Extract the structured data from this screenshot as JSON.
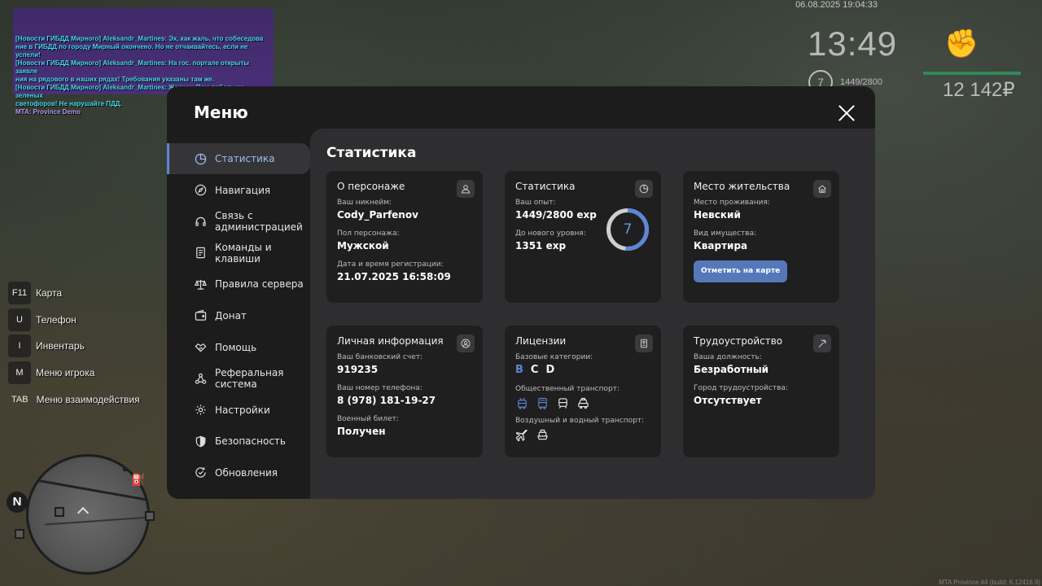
{
  "hud": {
    "datetime": "06.08.2025 19:04:33",
    "clock": "13:49",
    "level": "7",
    "exp": "1449/2800",
    "money": "12 142₽",
    "build": "MTA Province #4 (build: 6.12416.9)"
  },
  "chat": {
    "lines": [
      "[Новости ГИБДД Мирного] Aleksandr_Martines: Эх, как жаль, что собеседова",
      "ние в ГИБДД по городу Мирный окончено. Но не отчаивайтесь, если не успели!",
      "[Новости ГИБДД Мирного] Aleksandr_Martines: На гос. портале открыты заявле",
      "ния на рядового в наших рядах! Требования указаны там же.",
      "[Новости ГИБДД Мирного] Aleksandr_Martines: Желаем Вам побольше зеленых",
      " светофоров! Не нарушайте ПДД."
    ],
    "footer": "MTA: Province Demo"
  },
  "hotkeys": [
    {
      "key": "F11",
      "label": "Карта"
    },
    {
      "key": "U",
      "label": "Телефон"
    },
    {
      "key": "I",
      "label": "Инвентарь"
    },
    {
      "key": "M",
      "label": "Меню игрока"
    },
    {
      "key": "TAB",
      "label": "Меню взаимодействия"
    }
  ],
  "minimap": {
    "compass": "N"
  },
  "menu": {
    "title": "Меню",
    "nav": [
      {
        "label": "Статистика",
        "icon": "pie-chart-icon"
      },
      {
        "label": "Навигация",
        "icon": "compass-icon"
      },
      {
        "label": "Связь с администрацией",
        "icon": "headset-icon"
      },
      {
        "label": "Команды и клавиши",
        "icon": "document-icon"
      },
      {
        "label": "Правила сервера",
        "icon": "scales-icon"
      },
      {
        "label": "Донат",
        "icon": "wallet-icon"
      },
      {
        "label": "Помощь",
        "icon": "handshake-icon"
      },
      {
        "label": "Реферальная система",
        "icon": "network-icon"
      },
      {
        "label": "Настройки",
        "icon": "gear-icon"
      },
      {
        "label": "Безопасность",
        "icon": "shield-icon"
      },
      {
        "label": "Обновления",
        "icon": "refresh-check-icon"
      }
    ],
    "content_title": "Статистика",
    "cards": {
      "character": {
        "title": "О персонаже",
        "icon": "user-icon",
        "nickname_label": "Ваш никнейм:",
        "nickname": "Cody_Parfenov",
        "gender_label": "Пол персонажа:",
        "gender": "Мужской",
        "reg_label": "Дата и время регистрации:",
        "reg": "21.07.2025 16:58:09"
      },
      "stats": {
        "title": "Статистика",
        "icon": "pie-chart-icon",
        "exp_label": "Ваш опыт:",
        "exp": "1449/2800 exp",
        "next_label": "До нового уровня:",
        "next": "1351 exp",
        "level": "7",
        "progress": 0.5175,
        "ring_color": "#5d86d6",
        "ring_track": "#cfcfcf"
      },
      "residence": {
        "title": "Место жительства",
        "icon": "home-icon",
        "place_label": "Место проживания:",
        "place": "Невский",
        "property_label": "Вид имущества:",
        "property": "Квартира",
        "button": "Отметить на карте"
      },
      "personal": {
        "title": "Личная информация",
        "icon": "user-circle-icon",
        "bank_label": "Ваш банковский счет:",
        "bank": "919235",
        "phone_label": "Ваш номер телефона:",
        "phone": "8 (978) 181-19-27",
        "military_label": "Военный билет:",
        "military": "Получен"
      },
      "licenses": {
        "title": "Лицензии",
        "icon": "id-card-icon",
        "base_label": "Базовые категории:",
        "categories": [
          "B",
          "C",
          "D"
        ],
        "public_label": "Общественный транспорт:",
        "air_label": "Воздушный и водный транспорт:"
      },
      "job": {
        "title": "Трудоустройство",
        "icon": "pickaxe-icon",
        "position_label": "Ваша должность:",
        "position": "Безработный",
        "city_label": "Город трудоустройства:",
        "city": "Отсутствует"
      }
    }
  }
}
